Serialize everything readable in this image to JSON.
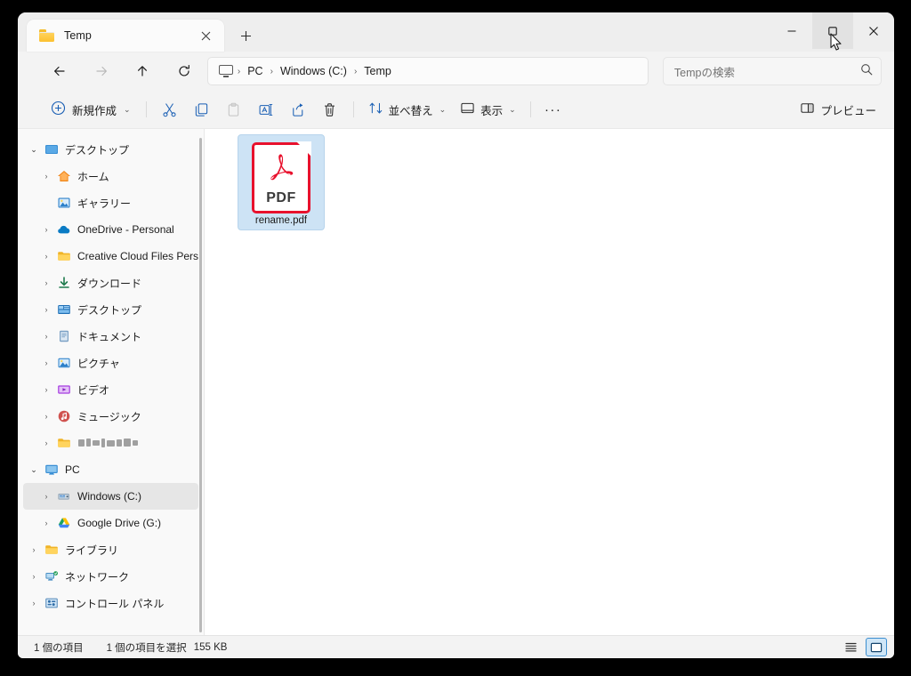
{
  "window": {
    "controls": {
      "minimize_label": "最小化",
      "maximize_label": "最大化",
      "close_label": "閉じる"
    }
  },
  "tabs": {
    "items": [
      {
        "label": "Temp",
        "icon": "folder-icon",
        "close_label": "×"
      }
    ],
    "new_tab_label": "+"
  },
  "navigation": {
    "back_label": "戻る",
    "forward_label": "進む",
    "up_label": "上へ",
    "refresh_label": "更新"
  },
  "breadcrumb": {
    "root_icon": "pc-monitor-icon",
    "separator": "›",
    "items": [
      {
        "label": "PC"
      },
      {
        "label": "Windows (C:)"
      },
      {
        "label": "Temp"
      }
    ]
  },
  "search": {
    "placeholder": "Tempの検索",
    "value": "",
    "icon": "search-icon"
  },
  "toolbar": {
    "new_label": "新規作成",
    "new_chevron": "⌄",
    "cut_label": "切り取り",
    "copy_label": "コピー",
    "paste_label": "貼り付け",
    "rename_label": "名前の変更",
    "share_label": "共有",
    "delete_label": "削除",
    "sort_label": "並べ替え",
    "sort_chevron": "⌄",
    "view_label": "表示",
    "view_chevron": "⌄",
    "more_label": "···",
    "preview_label": "プレビュー"
  },
  "sidebar": {
    "items": [
      {
        "label": "デスクトップ",
        "icon": "desktop-icon",
        "expander": "⌄",
        "expanded": true,
        "indent": 0,
        "selected": false
      },
      {
        "label": "ホーム",
        "icon": "home-icon",
        "expander": "›",
        "expanded": false,
        "indent": 1,
        "selected": false
      },
      {
        "label": "ギャラリー",
        "icon": "gallery-icon",
        "expander": "",
        "expanded": false,
        "indent": 1,
        "selected": false
      },
      {
        "label": "OneDrive - Personal",
        "icon": "onedrive-icon",
        "expander": "›",
        "expanded": false,
        "indent": 1,
        "selected": false
      },
      {
        "label": "Creative Cloud Files Personal",
        "icon": "folder-icon",
        "expander": "›",
        "expanded": false,
        "indent": 1,
        "selected": false
      },
      {
        "label": "ダウンロード",
        "icon": "downloads-icon",
        "expander": "›",
        "expanded": false,
        "indent": 1,
        "selected": false
      },
      {
        "label": "デスクトップ",
        "icon": "desktop-folder-icon",
        "expander": "›",
        "expanded": false,
        "indent": 1,
        "selected": false
      },
      {
        "label": "ドキュメント",
        "icon": "documents-icon",
        "expander": "›",
        "expanded": false,
        "indent": 1,
        "selected": false
      },
      {
        "label": "ピクチャ",
        "icon": "pictures-icon",
        "expander": "›",
        "expanded": false,
        "indent": 1,
        "selected": false
      },
      {
        "label": "ビデオ",
        "icon": "videos-icon",
        "expander": "›",
        "expanded": false,
        "indent": 1,
        "selected": false
      },
      {
        "label": "ミュージック",
        "icon": "music-icon",
        "expander": "›",
        "expanded": false,
        "indent": 1,
        "selected": false
      },
      {
        "label": "",
        "icon": "folder-icon",
        "expander": "›",
        "expanded": false,
        "indent": 1,
        "selected": false,
        "redacted": true
      },
      {
        "label": "PC",
        "icon": "pc-icon",
        "expander": "⌄",
        "expanded": true,
        "indent": 0,
        "selected": false
      },
      {
        "label": "Windows (C:)",
        "icon": "drive-icon",
        "expander": "›",
        "expanded": false,
        "indent": 1,
        "selected": true
      },
      {
        "label": "Google Drive (G:)",
        "icon": "google-drive-icon",
        "expander": "›",
        "expanded": false,
        "indent": 1,
        "selected": false
      },
      {
        "label": "ライブラリ",
        "icon": "folder-icon",
        "expander": "›",
        "expanded": false,
        "indent": 0,
        "selected": false
      },
      {
        "label": "ネットワーク",
        "icon": "network-icon",
        "expander": "›",
        "expanded": false,
        "indent": 0,
        "selected": false
      },
      {
        "label": "コントロール パネル",
        "icon": "control-panel-icon",
        "expander": "›",
        "expanded": false,
        "indent": 0,
        "selected": false
      }
    ]
  },
  "files": {
    "items": [
      {
        "name": "rename.pdf",
        "icon": "pdf-icon",
        "badge": "PDF",
        "selected": true
      }
    ]
  },
  "statusbar": {
    "item_count": "1 個の項目",
    "selection": "1 個の項目を選択",
    "size": "155 KB",
    "details_view_label": "詳細表示",
    "large_icons_view_label": "大アイコン表示"
  },
  "colors": {
    "accent": "#0f6cbd",
    "selection": "#cde3f5",
    "pdf_red": "#e8112d",
    "window_bg": "#f3f3f3"
  }
}
